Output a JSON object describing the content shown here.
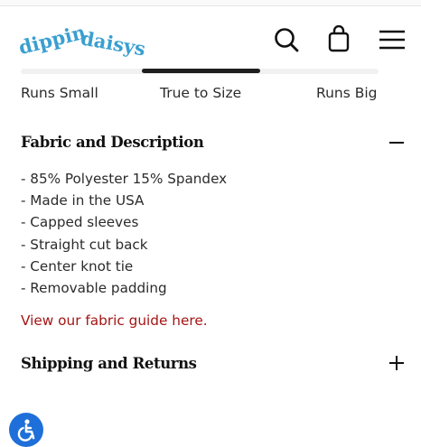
{
  "header": {
    "logo_text": "dippin daisys",
    "colors": {
      "logo": "#3a9fd0",
      "accent": "#a51414",
      "a11y": "#1e6fd9"
    },
    "icons": [
      "search-icon",
      "shopping-bag-icon",
      "hamburger-menu-icon"
    ]
  },
  "fit_scale": {
    "labels": {
      "small": "Runs Small",
      "true": "True to Size",
      "big": "Runs Big"
    }
  },
  "accordions": [
    {
      "title": "Fabric and Description",
      "toggle": "−",
      "items": [
        "- 85% Polyester 15% Spandex",
        "- Made in the USA",
        "- Capped sleeves",
        "- Straight cut back",
        "- Center knot tie",
        "- Removable padding"
      ],
      "link": "View our fabric guide here."
    },
    {
      "title": "Shipping and Returns",
      "toggle": "+"
    }
  ],
  "accessibility": {
    "icon": "accessibility-icon"
  }
}
